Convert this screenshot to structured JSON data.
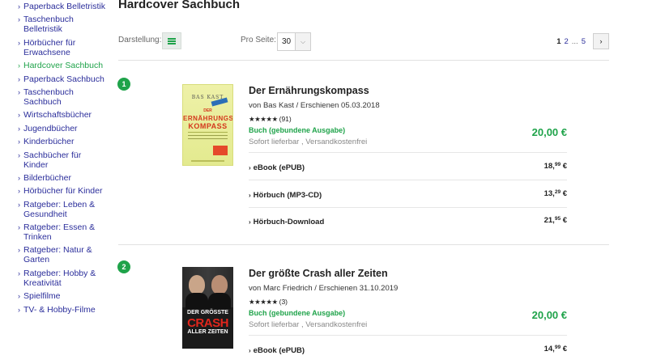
{
  "sidebar": {
    "items": [
      {
        "label": "Paperback Belletristik",
        "active": false
      },
      {
        "label": "Taschenbuch Belletristik",
        "active": false
      },
      {
        "label": "Hörbücher für Erwachsene",
        "active": false
      },
      {
        "label": "Hardcover Sachbuch",
        "active": true
      },
      {
        "label": "Paperback Sachbuch",
        "active": false
      },
      {
        "label": "Taschenbuch Sachbuch",
        "active": false
      },
      {
        "label": "Wirtschaftsbücher",
        "active": false
      },
      {
        "label": "Jugendbücher",
        "active": false
      },
      {
        "label": "Kinderbücher",
        "active": false
      },
      {
        "label": "Sachbücher für Kinder",
        "active": false
      },
      {
        "label": "Bilderbücher",
        "active": false
      },
      {
        "label": "Hörbücher für Kinder",
        "active": false
      },
      {
        "label": "Ratgeber: Leben & Gesundheit",
        "active": false
      },
      {
        "label": "Ratgeber: Essen & Trinken",
        "active": false
      },
      {
        "label": "Ratgeber: Natur & Garten",
        "active": false
      },
      {
        "label": "Ratgeber: Hobby & Kreativität",
        "active": false
      },
      {
        "label": "Spielfilme",
        "active": false
      },
      {
        "label": "TV- & Hobby-Filme",
        "active": false
      }
    ]
  },
  "header": {
    "title": "Hardcover Sachbuch"
  },
  "toolbar": {
    "view_label": "Darstellung:",
    "per_page_label": "Pro Seite:",
    "per_page_value": "30",
    "pages": {
      "current": "1",
      "next_page": "2",
      "ellipsis": "...",
      "last": "5"
    },
    "next_icon": "chevron-right-icon"
  },
  "products": [
    {
      "rank": "1",
      "title": "Der Ernährungskompass",
      "meta": "von Bas Kast / Erschienen 05.03.2018",
      "stars": "★★★★★",
      "rating_count": "(91)",
      "format": "Buch (gebundene Ausgabe)",
      "availability": "Sofort lieferbar , Versandkostenfrei",
      "price": "20,00 €",
      "cover": {
        "author": "BAS KAST",
        "title_top": "DER",
        "title_1": "ERNÄHRUNGS",
        "title_2": "KOMPASS"
      },
      "options": [
        {
          "label": "eBook (ePUB)",
          "price_main": "18,",
          "price_cents": "99",
          "price_cur": " €"
        },
        {
          "label": "Hörbuch (MP3-CD)",
          "price_main": "13,",
          "price_cents": "29",
          "price_cur": " €"
        },
        {
          "label": "Hörbuch-Download",
          "price_main": "21,",
          "price_cents": "95",
          "price_cur": " €"
        }
      ]
    },
    {
      "rank": "2",
      "title": "Der größte Crash aller Zeiten",
      "meta": "von Marc Friedrich / Erschienen 31.10.2019",
      "stars": "★★★★★",
      "rating_count": "(3)",
      "format": "Buch (gebundene Ausgabe)",
      "availability": "Sofort lieferbar , Versandkostenfrei",
      "price": "20,00 €",
      "cover": {
        "line_1": "DER GRÖSSTE",
        "line_2": "CRASH",
        "line_3": "ALLER ZEITEN"
      },
      "options": [
        {
          "label": "eBook (ePUB)",
          "price_main": "14,",
          "price_cents": "99",
          "price_cur": " €"
        }
      ]
    }
  ],
  "colors": {
    "accent": "#1fa34a",
    "link": "#2b2e9b"
  }
}
